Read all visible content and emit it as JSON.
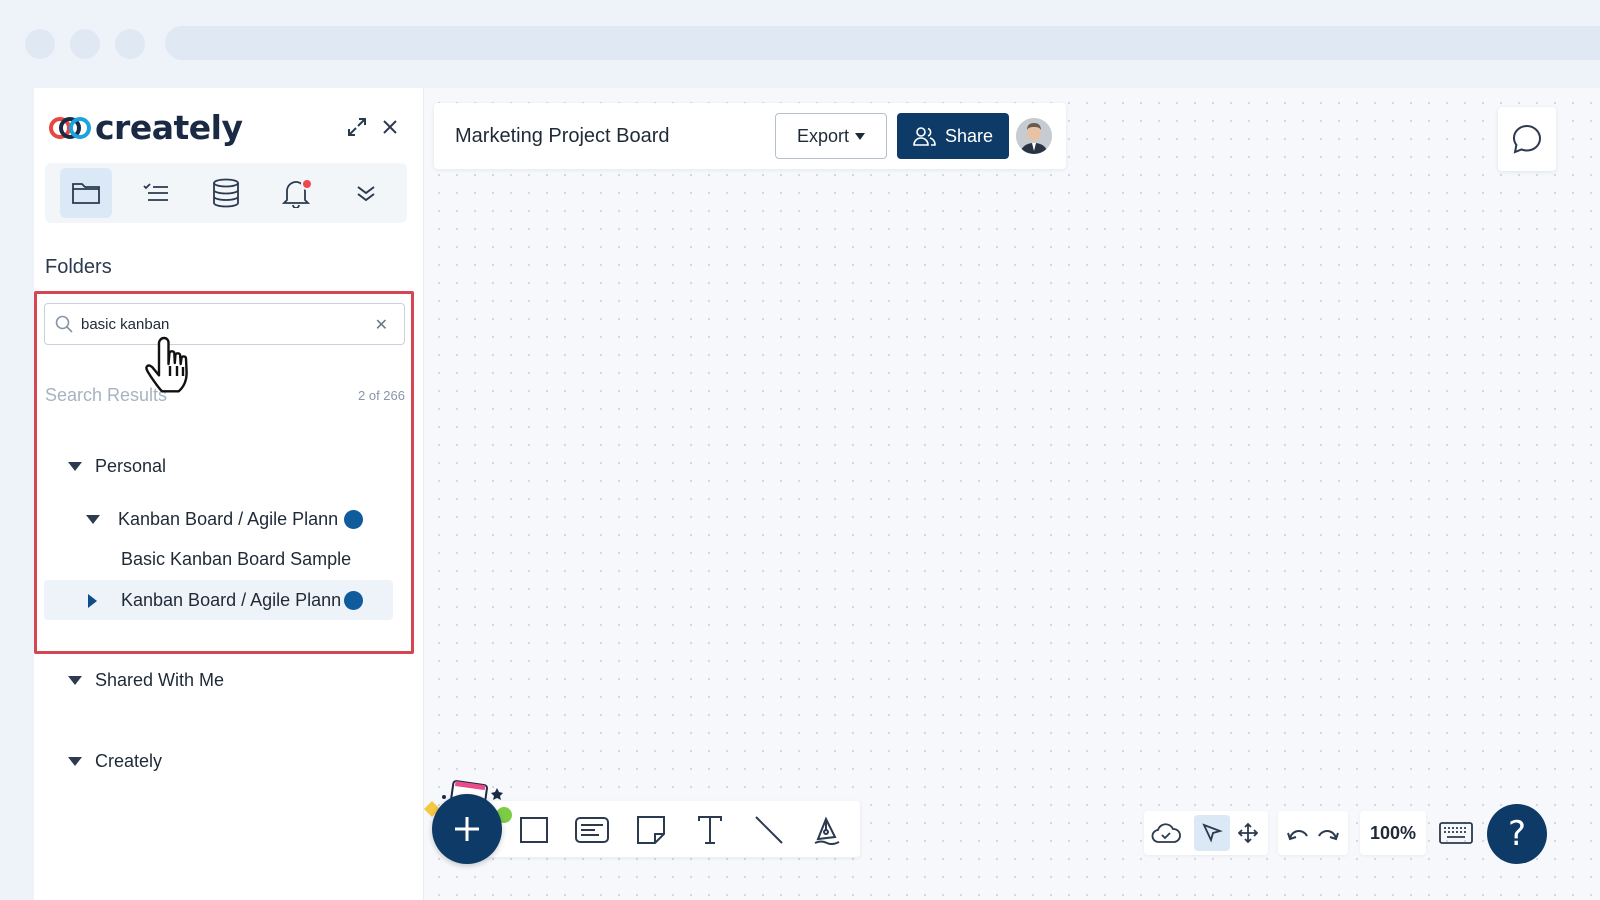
{
  "app": {
    "logo_text": "creately"
  },
  "sidebar": {
    "tabs": [
      {
        "icon": "folder-icon",
        "active": true
      },
      {
        "icon": "checklist-icon",
        "active": false
      },
      {
        "icon": "database-icon",
        "active": false
      },
      {
        "icon": "bell-icon",
        "active": false,
        "has_notification": true
      },
      {
        "icon": "chevrons-down-icon",
        "active": false
      }
    ],
    "folders_title": "Folders",
    "search": {
      "value": "basic kanban",
      "placeholder": ""
    },
    "results_label": "Search Results",
    "results_count": "2 of 266",
    "tree": {
      "personal": "Personal",
      "kanban_1": "Kanban Board / Agile Plann",
      "basic_sample": "Basic Kanban Board Sample",
      "kanban_2": "Kanban Board / Agile Plann",
      "shared": "Shared With Me",
      "creately": "Creately"
    }
  },
  "topbar": {
    "title": "Marketing Project Board",
    "export_label": "Export",
    "share_label": "Share"
  },
  "bottom": {
    "zoom": "100%",
    "help_label": "?"
  },
  "colors": {
    "primary": "#0e3a67",
    "highlight_border": "#d64553",
    "notification": "#f0484e"
  }
}
